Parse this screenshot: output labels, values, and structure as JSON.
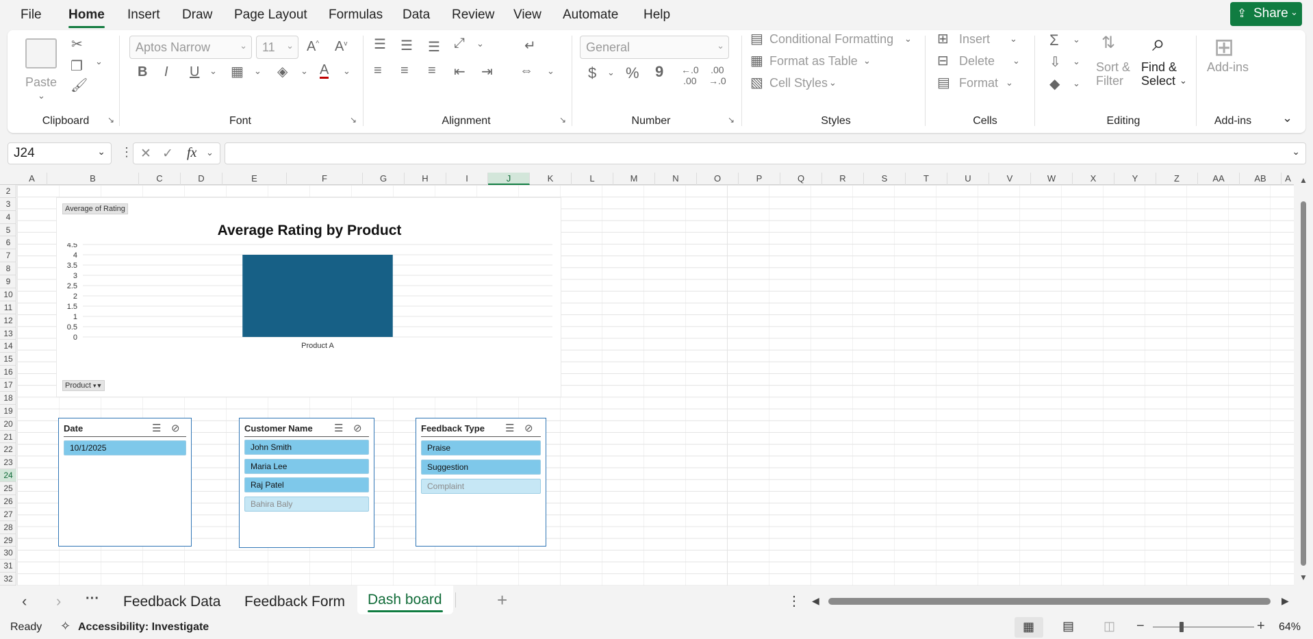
{
  "menu": {
    "items": [
      "File",
      "Home",
      "Insert",
      "Draw",
      "Page Layout",
      "Formulas",
      "Data",
      "Review",
      "View",
      "Automate",
      "Help"
    ],
    "active": "Home",
    "share_label": "Share"
  },
  "ribbon": {
    "clipboard": {
      "paste_label": "Paste",
      "group_label": "Clipboard"
    },
    "font": {
      "font_name": "Aptos Narrow",
      "font_size": "11",
      "bold": "B",
      "italic": "I",
      "underline": "U",
      "font_color_glyph": "A",
      "group_label": "Font"
    },
    "alignment": {
      "group_label": "Alignment"
    },
    "number": {
      "format": "General",
      "currency": "$",
      "percent": "%",
      "comma": "9",
      "group_label": "Number"
    },
    "styles": {
      "conditional_formatting": "Conditional Formatting",
      "format_as_table": "Format as Table",
      "cell_styles": "Cell Styles",
      "group_label": "Styles"
    },
    "cells": {
      "insert": "Insert",
      "delete": "Delete",
      "format": "Format",
      "group_label": "Cells"
    },
    "editing": {
      "sort_filter_line1": "Sort &",
      "sort_filter_line2": "Filter",
      "find_select_line1": "Find &",
      "find_select_line2": "Select",
      "group_label": "Editing"
    },
    "addins": {
      "label": "Add-ins",
      "group_label": "Add-ins"
    }
  },
  "formula_bar": {
    "name_box": "J24",
    "fx": "fx",
    "formula": ""
  },
  "grid": {
    "columns": [
      "A",
      "B",
      "C",
      "D",
      "E",
      "F",
      "G",
      "H",
      "I",
      "J",
      "K",
      "L",
      "M",
      "N",
      "O",
      "P",
      "Q",
      "R",
      "S",
      "T",
      "U",
      "V",
      "W",
      "X",
      "Y",
      "Z",
      "AA",
      "AB",
      "A"
    ],
    "selected_column": "J",
    "rows": [
      "2",
      "3",
      "4",
      "5",
      "6",
      "7",
      "8",
      "9",
      "10",
      "11",
      "12",
      "13",
      "14",
      "15",
      "16",
      "17",
      "18",
      "19",
      "20",
      "21",
      "22",
      "23",
      "24",
      "25",
      "26",
      "27",
      "28",
      "29",
      "30",
      "31",
      "32"
    ],
    "selected_row": "24"
  },
  "pivot_chart": {
    "value_field_button": "Average of Rating",
    "axis_field_button": "Product",
    "colors": {
      "bar": "#176086"
    }
  },
  "chart_data": {
    "type": "bar",
    "title": "Average Rating by Product",
    "categories": [
      "Product A"
    ],
    "values": [
      4
    ],
    "ylim": [
      0,
      4.5
    ],
    "yticks": [
      "4.5",
      "4",
      "3.5",
      "3",
      "2.5",
      "2",
      "1.5",
      "1",
      "0.5",
      "0"
    ],
    "xlabel": "",
    "ylabel": "",
    "grid": true
  },
  "slicers": {
    "date": {
      "title": "Date",
      "items": [
        {
          "label": "10/1/2025",
          "selected": true
        }
      ]
    },
    "customer": {
      "title": "Customer Name",
      "items": [
        {
          "label": "John Smith",
          "selected": true
        },
        {
          "label": "Maria Lee",
          "selected": true
        },
        {
          "label": "Raj Patel",
          "selected": true
        },
        {
          "label": "Bahira Baly",
          "selected": false
        }
      ]
    },
    "feedback": {
      "title": "Feedback Type",
      "items": [
        {
          "label": "Praise",
          "selected": true
        },
        {
          "label": "Suggestion",
          "selected": true
        },
        {
          "label": "Complaint",
          "selected": false
        }
      ]
    }
  },
  "sheet_tabs": {
    "tabs": [
      "Feedback Data",
      "Feedback Form",
      "Dash board"
    ],
    "active": "Dash board"
  },
  "status_bar": {
    "ready": "Ready",
    "accessibility": "Accessibility: Investigate",
    "zoom": "64%"
  }
}
